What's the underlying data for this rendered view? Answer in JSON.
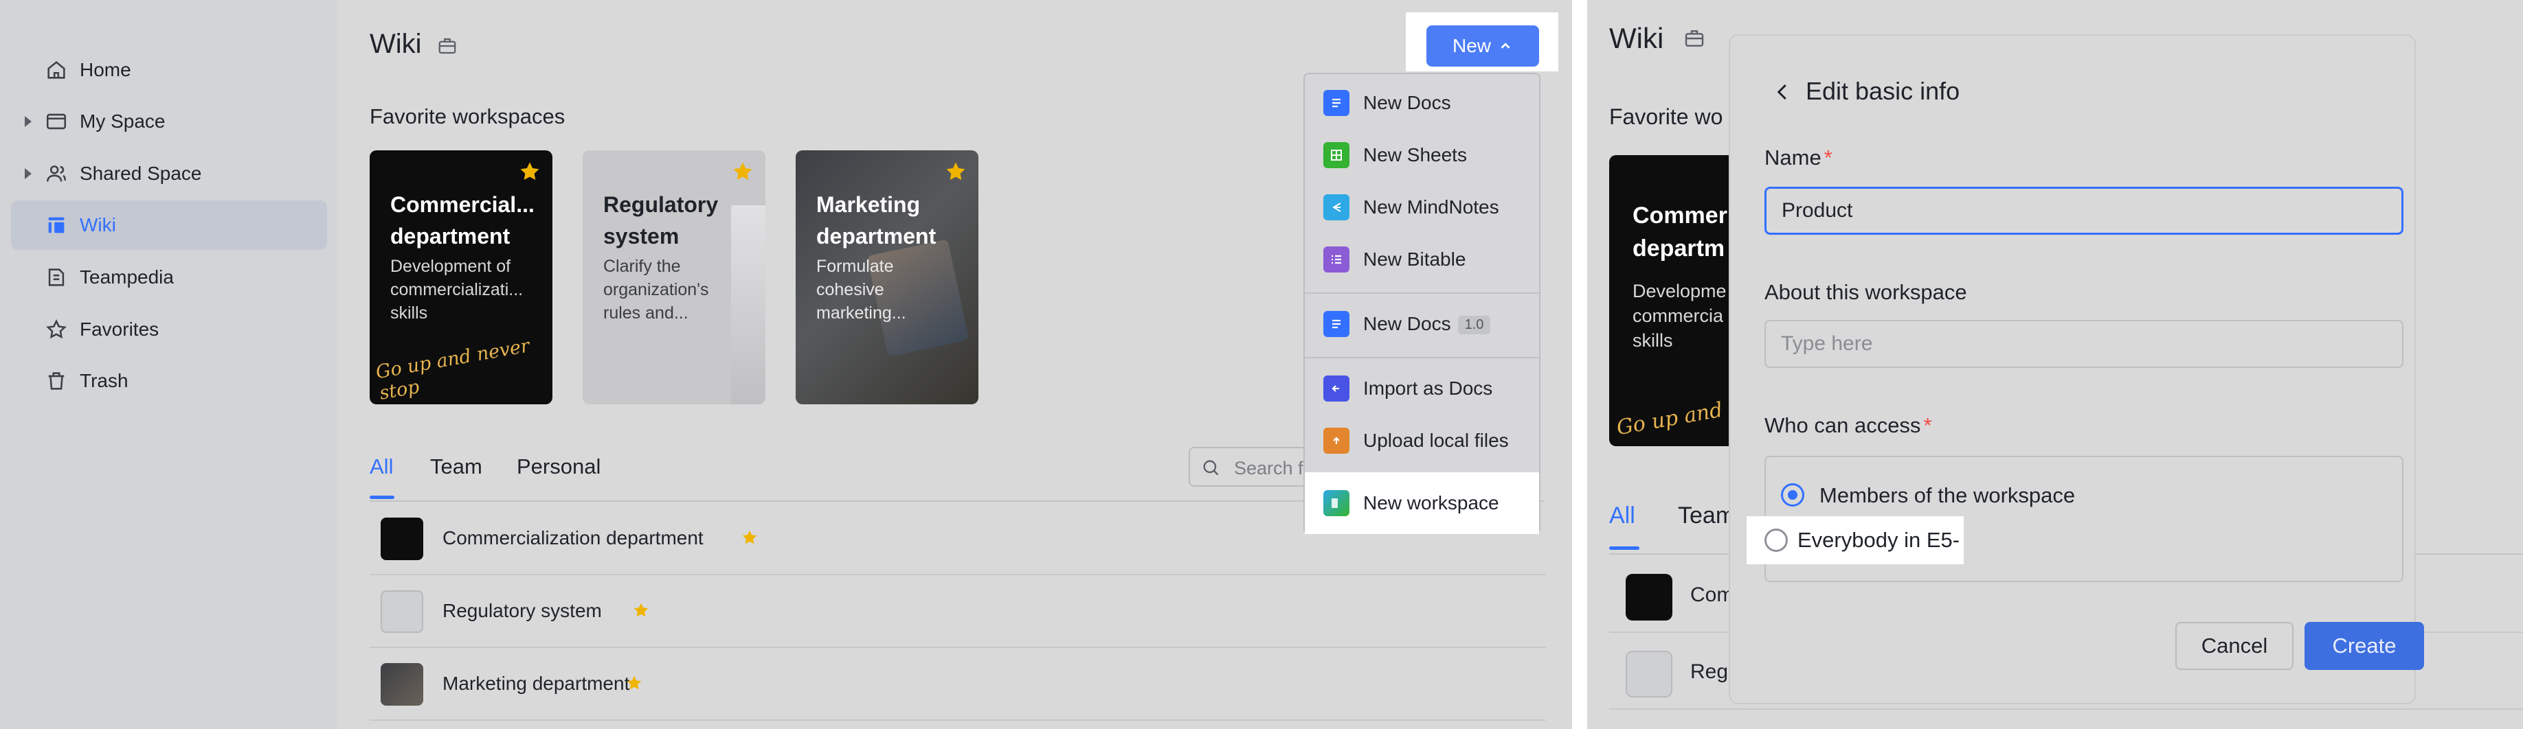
{
  "colors": {
    "accent": "#3370ff",
    "star": "#f0b400",
    "required": "#f54a45"
  },
  "sidebar": {
    "items": [
      {
        "label": "Home",
        "icon": "home-icon",
        "expandable": false
      },
      {
        "label": "My Space",
        "icon": "folder-icon",
        "expandable": true
      },
      {
        "label": "Shared Space",
        "icon": "users-icon",
        "expandable": true
      },
      {
        "label": "Wiki",
        "icon": "wiki-icon",
        "expandable": false,
        "active": true
      },
      {
        "label": "Teampedia",
        "icon": "book-icon",
        "expandable": false
      },
      {
        "label": "Favorites",
        "icon": "star-icon",
        "expandable": false
      },
      {
        "label": "Trash",
        "icon": "trash-icon",
        "expandable": false
      }
    ]
  },
  "main": {
    "title": "Wiki",
    "new_button": "New",
    "favorites_title": "Favorite workspaces",
    "cards": [
      {
        "title_line1": "Commercial...",
        "title_line2": "department",
        "desc_line1": "Development of",
        "desc_line2": "commercializati...",
        "desc_line3": "skills",
        "scribble": "Go up and never stop"
      },
      {
        "title_line1": "Regulatory",
        "title_line2": "system",
        "desc_line1": "Clarify the",
        "desc_line2": "organization's",
        "desc_line3": "rules and..."
      },
      {
        "title_line1": "Marketing",
        "title_line2": "department",
        "desc_line1": "Formulate",
        "desc_line2": "cohesive",
        "desc_line3": "marketing..."
      }
    ],
    "tabs": [
      "All",
      "Team",
      "Personal"
    ],
    "search_placeholder": "Search f",
    "rows": [
      "Commercialization department",
      "Regulatory system",
      "Marketing department"
    ]
  },
  "dropdown": {
    "items": [
      {
        "label": "New Docs",
        "icon": "docs-icon",
        "color": "#3370ff"
      },
      {
        "label": "New Sheets",
        "icon": "sheets-icon",
        "color": "#34b233"
      },
      {
        "label": "New MindNotes",
        "icon": "mindnotes-icon",
        "color": "#2ea9e6"
      },
      {
        "label": "New Bitable",
        "icon": "bitable-icon",
        "color": "#8b5cd6"
      },
      {
        "label": "New Docs",
        "icon": "docs-icon",
        "color": "#3370ff",
        "badge": "1.0"
      },
      {
        "label": "Import as Docs",
        "icon": "import-icon",
        "color": "#4954e6"
      },
      {
        "label": "Upload local files",
        "icon": "upload-icon",
        "color": "#e2852c"
      },
      {
        "label": "New workspace",
        "icon": "workspace-icon",
        "color": "#3aa8d8"
      }
    ]
  },
  "right": {
    "title": "Wiki",
    "favorites_title": "Favorite wo",
    "card": {
      "title_line1": "Commer",
      "title_line2": "departm",
      "desc_line1": "Developme",
      "desc_line2": "commercia",
      "desc_line3": "skills",
      "scribble": "Go up and"
    },
    "tabs": [
      "All",
      "Team"
    ],
    "rows": [
      "Com",
      "Regu"
    ],
    "modal": {
      "title": "Edit basic info",
      "name_label": "Name",
      "name_value": "Product",
      "about_label": "About this workspace",
      "about_placeholder": "Type here",
      "access_label": "Who can access",
      "options": [
        "Members of the workspace",
        "Everybody in E5-"
      ],
      "selected_option": "Members of the workspace",
      "cancel": "Cancel",
      "create": "Create"
    }
  }
}
